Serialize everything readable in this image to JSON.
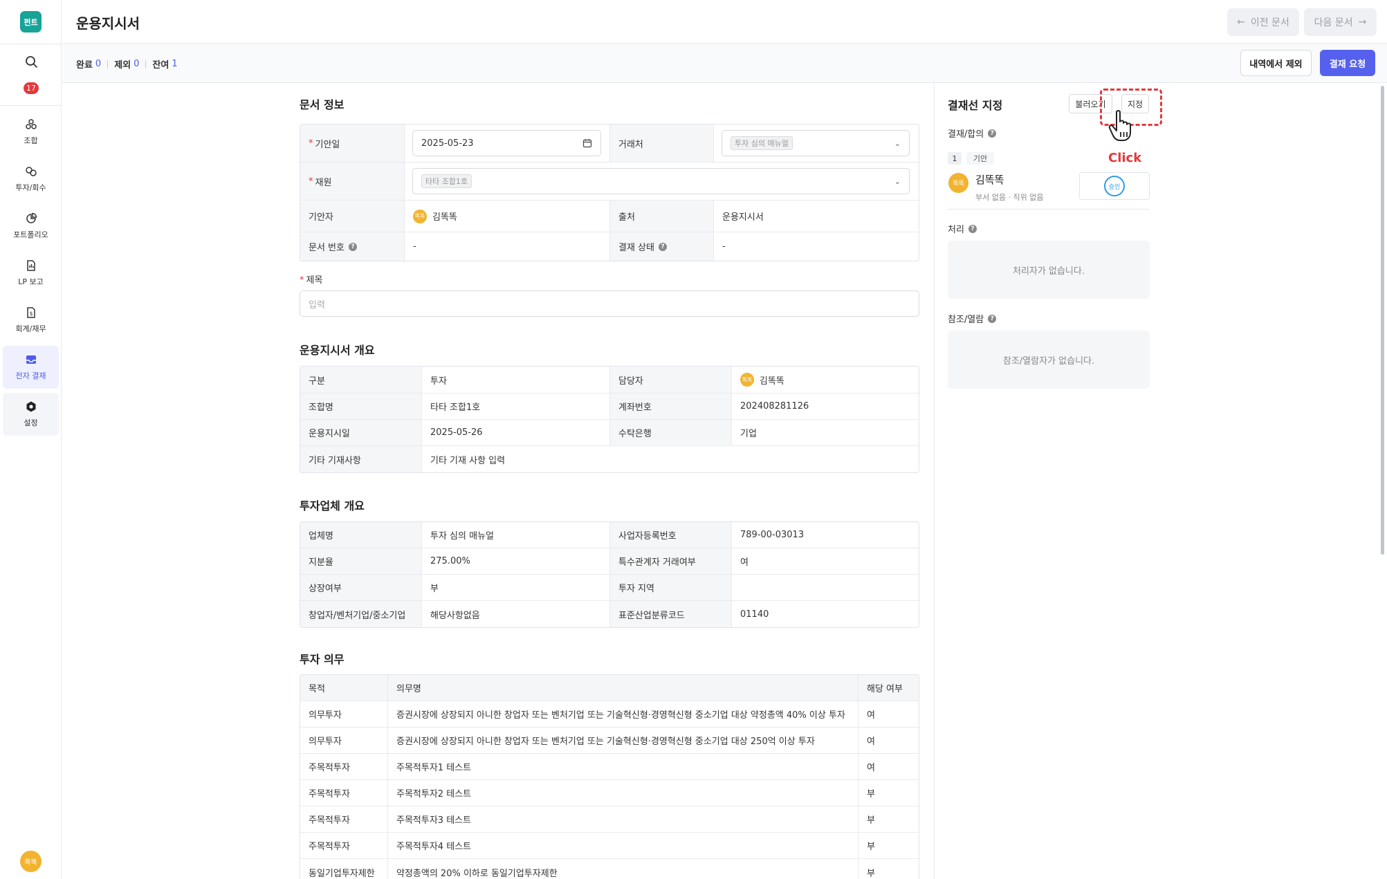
{
  "app": {
    "logo_text": "펀트",
    "notification_count": "17",
    "user_avatar": "똑똑"
  },
  "sidebar": {
    "items": [
      {
        "label": "조합",
        "icon": "union-icon"
      },
      {
        "label": "투자/회수",
        "icon": "invest-icon"
      },
      {
        "label": "포트폴리오",
        "icon": "portfolio-icon"
      },
      {
        "label": "LP 보고",
        "icon": "report-icon"
      },
      {
        "label": "회계/재무",
        "icon": "accounting-icon"
      },
      {
        "label": "전자 결재",
        "icon": "inbox-icon"
      },
      {
        "label": "설정",
        "icon": "gear-icon"
      }
    ]
  },
  "header": {
    "title": "운용지시서",
    "prev_label": "이전 문서",
    "next_label": "다음 문서"
  },
  "subbar": {
    "done_label": "완료",
    "done_count": "0",
    "excluded_label": "제외",
    "excluded_count": "0",
    "remaining_label": "잔여",
    "remaining_count": "1",
    "exclude_button": "내역에서 제외",
    "approval_button": "결재 요청"
  },
  "doc_info": {
    "title": "문서 정보",
    "draft_date_label": "기안일",
    "draft_date_value": "2025-05-23",
    "client_label": "거래처",
    "client_tag": "투자 심의 매뉴얼",
    "fund_label": "재원",
    "fund_tag": "타타 조합1호",
    "drafter_label": "기안자",
    "drafter_avatar": "똑똑",
    "drafter_name": "김똑똑",
    "source_label": "출처",
    "source_value": "운용지시서",
    "docno_label": "문서 번호",
    "docno_value": "-",
    "status_label": "결재 상태",
    "status_value": "-",
    "subject_label": "제목",
    "subject_placeholder": "입력"
  },
  "overview": {
    "title": "운용지시서 개요",
    "rows": [
      {
        "k1": "구분",
        "v1": "투자",
        "k2": "담당자",
        "v2": "김똑똑",
        "avatar": "똑똑"
      },
      {
        "k1": "조합명",
        "v1": "타타 조합1호",
        "k2": "계좌번호",
        "v2": "202408281126"
      },
      {
        "k1": "운용지시일",
        "v1": "2025-05-26",
        "k2": "수탁은행",
        "v2": "기업"
      }
    ],
    "extra_label": "기타 기재사항",
    "extra_value": "기타 기재 사항 입력"
  },
  "company": {
    "title": "투자업체 개요",
    "rows": [
      {
        "k1": "업체명",
        "v1": "투자 심의 매뉴얼",
        "k2": "사업자등록번호",
        "v2": "789-00-03013"
      },
      {
        "k1": "지분율",
        "v1": "275.00%",
        "k2": "특수관계자 거래여부",
        "v2": "여"
      },
      {
        "k1": "상장여부",
        "v1": "부",
        "k2": "투자 지역",
        "v2": ""
      },
      {
        "k1": "창업자/벤처기업/중소기업",
        "v1": "해당사항없음",
        "k2": "표준산업분류코드",
        "v2": "01140"
      }
    ]
  },
  "obligations": {
    "title": "투자 의무",
    "headers": [
      "목적",
      "의무명",
      "해당 여부"
    ],
    "rows": [
      [
        "의무투자",
        "증권시장에 상장되지 아니한 창업자 또는 벤처기업 또는 기술혁신형·경영혁신형 중소기업 대상 약정총액 40% 이상 투자",
        "여"
      ],
      [
        "의무투자",
        "증권시장에 상장되지 아니한 창업자 또는 벤처기업 또는 기술혁신형·경영혁신형 중소기업 대상 250억 이상 투자",
        "여"
      ],
      [
        "주목적투자",
        "주목적투자1 테스트",
        "여"
      ],
      [
        "주목적투자",
        "주목적투자2 테스트",
        "부"
      ],
      [
        "주목적투자",
        "주목적투자3 테스트",
        "부"
      ],
      [
        "주목적투자",
        "주목적투자4 테스트",
        "부"
      ],
      [
        "동일기업투자제한",
        "약정총액의 20% 이하로 동일기업투자제한",
        "부"
      ]
    ]
  },
  "approval_panel": {
    "title": "결재선 지정",
    "load_button": "불러오기",
    "assign_button": "지정",
    "click_hint": "Click",
    "approval_label": "결재/합의",
    "step_no": "1",
    "step_label": "기안",
    "approver_avatar": "똑똑",
    "approver_name": "김똑똑",
    "approver_sub": "부서 없음 · 직위 없음",
    "approve_stamp": "승인",
    "process_label": "처리",
    "process_empty": "처리자가 없습니다.",
    "ref_label": "참조/열람",
    "ref_empty": "참조/열람자가 없습니다."
  }
}
